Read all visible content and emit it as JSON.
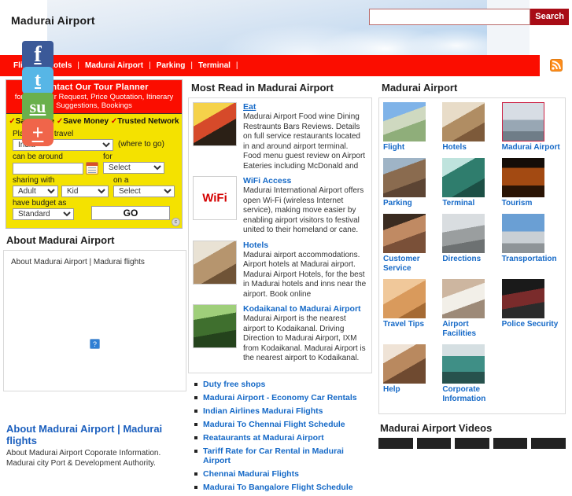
{
  "header": {
    "site_title": "Madurai Airport",
    "search_value": "",
    "search_placeholder": "",
    "search_button": "Search",
    "rss_icon": "rss-icon"
  },
  "nav": {
    "items": [
      {
        "label": "Flight"
      },
      {
        "label": "Hotels"
      },
      {
        "label": "Madurai Airport"
      },
      {
        "label": "Parking"
      },
      {
        "label": "Terminal"
      }
    ],
    "separator": "|"
  },
  "planner": {
    "title": "Contact Our Tour Planner",
    "subtitle": "for right Tour Request, Price Quotation, Itinerary Suggestions, Bookings",
    "usps": [
      "Save Time",
      "Save Money",
      "Trusted Network"
    ],
    "check_mark": "✓",
    "label_destination": "Planning to travel",
    "destination_value": "India",
    "hint_where": "(where to go)",
    "label_around": "can be around",
    "date_value": "",
    "calendar_icon": "calendar-icon",
    "label_for": "for",
    "for_value": "Select",
    "label_sharing": "sharing with",
    "sharing_value": "Adult",
    "kid_value": "Kid",
    "label_on_a": "on a",
    "on_a_value": "Select",
    "label_budget": "have budget as",
    "budget_value": "Standard",
    "go_button": "GO",
    "badge": "c"
  },
  "social": [
    {
      "name": "facebook-share-icon",
      "glyph": "f",
      "class": "fb"
    },
    {
      "name": "twitter-share-icon",
      "glyph": "t",
      "class": "tw"
    },
    {
      "name": "stumbleupon-share-icon",
      "glyph": "su",
      "class": "su"
    },
    {
      "name": "addthis-share-icon",
      "glyph": "+",
      "class": "plus"
    }
  ],
  "about": {
    "title": "About Madurai Airport",
    "inline_links": "About  Madurai Airport |  Madurai  flights",
    "broken_image_glyph": "?",
    "footer_title": "About Madurai Airport | Madurai flights",
    "footer_text": "About Madurai Airport Coporate Information. Madurai city Port & Development Authority."
  },
  "most_read": {
    "title": "Most Read in Madurai Airport",
    "articles": [
      {
        "title": "Eat",
        "text": "Madurai Airport Food wine Dining Restraunts Bars Reviews. Details on full service restaurants located in and around airport terminal. Food menu guest review on Airport Eateries including McDonald and",
        "thumb": "food-thumbnail"
      },
      {
        "title": "WiFi Access",
        "text": "Madurai International Airport offers open Wi-Fi (wireless Internet service), making move easier by enabling airport visitors to festival united to their homeland or cane.",
        "thumb": "wifi-thumbnail"
      },
      {
        "title": "Hotels",
        "text": "Madurai airport accommodations. Airport hotels at Madurai airport. Madurai Airport Hotels, for the best in Madurai hotels and inns near the airport. Book online",
        "thumb": "hotel-room-thumbnail"
      },
      {
        "title": "Kodaikanal to Madurai Airport",
        "text": "Madurai Airport is the nearest airport to Kodaikanal. Driving Direction to Madurai Airport, IXM from Kodaikanal. Madurai Airport is the nearest airport to Kodaikanal.",
        "thumb": "kodaikanal-thumbnail"
      }
    ],
    "links": [
      "Duty free shops",
      "Madurai Airport - Economy Car Rentals",
      "Indian Airlines Madurai Flights",
      "Madurai To Chennai Flight Schedule",
      "Reataurants at Madurai Airport",
      "Tariff Rate for Car Rental in Madurai Airport",
      "Chennai Madurai Flights",
      "Madurai To Bangalore Flight Schedule"
    ]
  },
  "categories": {
    "title": "Madurai Airport",
    "items": [
      {
        "label": "Flight",
        "image": "flight-runway-image",
        "class": "ph1",
        "framed": false
      },
      {
        "label": "Hotels",
        "image": "hotel-room-image",
        "class": "ph2",
        "framed": false
      },
      {
        "label": "Madurai Airport",
        "image": "airport-terminal-image",
        "class": "ph3",
        "framed": true
      },
      {
        "label": "Parking",
        "image": "parking-lot-image",
        "class": "ph4",
        "framed": false
      },
      {
        "label": "Terminal",
        "image": "terminal-interior-image",
        "class": "ph5",
        "framed": false
      },
      {
        "label": "Tourism",
        "image": "temple-tourism-image",
        "class": "ph6",
        "framed": false
      },
      {
        "label": "Customer Service",
        "image": "customer-service-image",
        "class": "ph7",
        "framed": false
      },
      {
        "label": "Directions",
        "image": "street-directions-image",
        "class": "ph8",
        "framed": false
      },
      {
        "label": "Transportation",
        "image": "transportation-image",
        "class": "ph9",
        "framed": false
      },
      {
        "label": "Travel Tips",
        "image": "travel-tips-image",
        "class": "ph10",
        "framed": false
      },
      {
        "label": "Airport Facilities",
        "image": "airport-facilities-image",
        "class": "ph11",
        "framed": false
      },
      {
        "label": "Police Security",
        "image": "police-security-image",
        "class": "ph12",
        "framed": false
      },
      {
        "label": "Help",
        "image": "help-operator-image",
        "class": "ph13",
        "framed": false
      },
      {
        "label": "Corporate Information",
        "image": "corporate-information-image",
        "class": "ph14",
        "framed": false
      }
    ]
  },
  "videos": {
    "title": "Madurai Airport Videos",
    "thumbs": [
      "video-thumb-1",
      "video-thumb-2",
      "video-thumb-3",
      "video-thumb-4",
      "video-thumb-5"
    ]
  },
  "colors": {
    "nav_red": "#fb0d00",
    "search_red": "#a80c16",
    "link_blue": "#1569c7",
    "planner_yellow": "#f4e200"
  }
}
